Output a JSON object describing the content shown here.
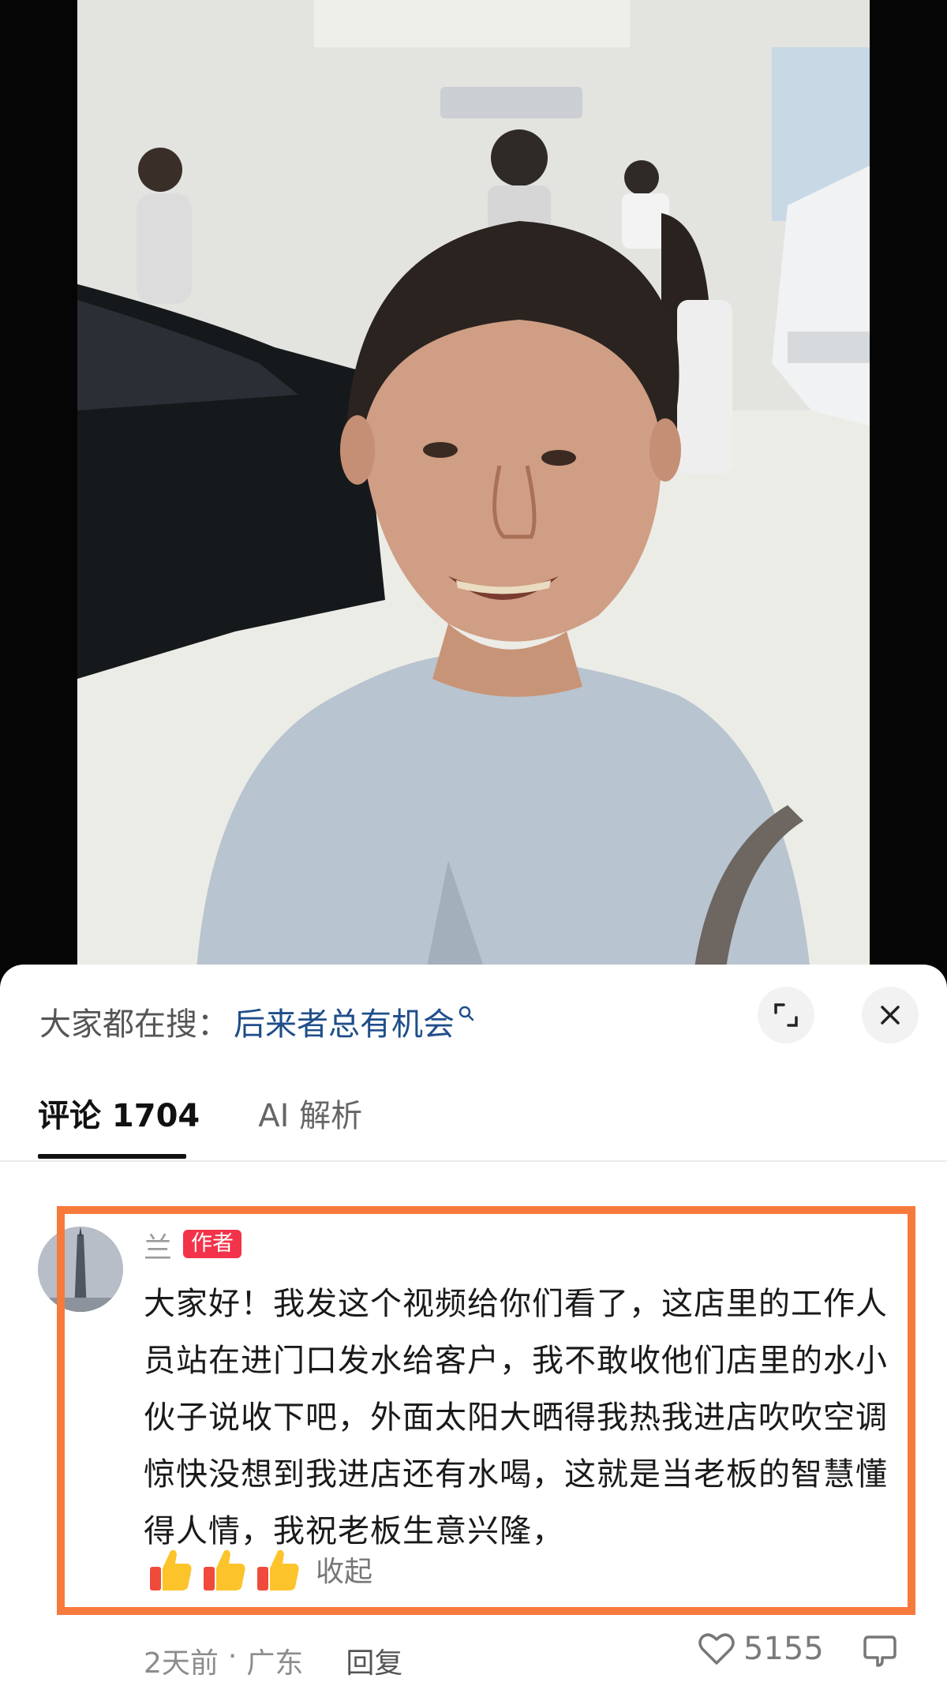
{
  "search_bar": {
    "prefix": "大家都在搜：",
    "query": "后来者总有机会",
    "query_icon": "search-icon"
  },
  "header_buttons": {
    "expand_icon": "expand-icon",
    "close_icon": "close-icon"
  },
  "tabs": [
    {
      "label": "评论 1704",
      "active": true
    },
    {
      "label": "AI 解析",
      "active": false
    }
  ],
  "comment": {
    "author": "兰",
    "badge": "作者",
    "text": "大家好！我发这个视频给你们看了，这店里的工作人员站在进门口发水给客户，我不敢收他们店里的水小伙子说收下吧，外面太阳大晒得我热我进店吹吹空调惊快没想到我进店还有水喝，这就是当老板的智慧懂得人情，我祝老板生意兴隆，",
    "emojis": [
      "thumbs-up-icon",
      "thumbs-up-icon",
      "thumbs-up-icon"
    ],
    "collapse_label": "收起",
    "time": "2天前",
    "separator": "·",
    "location": "广东",
    "reply_label": "回复",
    "like_count": "5155",
    "highlight_color": "#f77a3c"
  },
  "colors": {
    "search_query": "#1f4e8a",
    "badge": "#f2334a"
  }
}
